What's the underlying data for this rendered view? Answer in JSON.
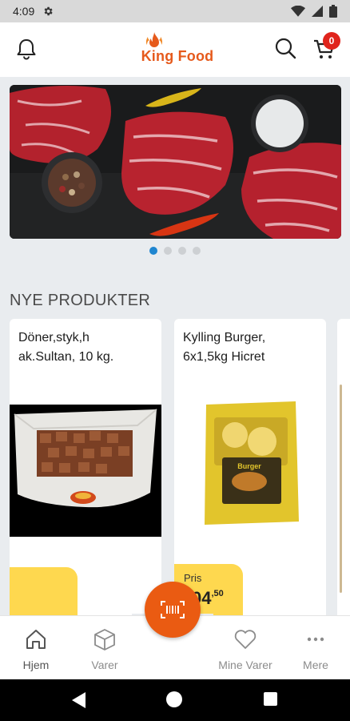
{
  "status_bar": {
    "time": "4:09"
  },
  "header": {
    "brand": "King Food",
    "cart_count": "0"
  },
  "banner": {
    "slides": 4,
    "active_slide": 1
  },
  "section": {
    "title": "NYE PRODUKTER"
  },
  "products": [
    {
      "name": "Döner,styk,h ak.Sultan, 10 kg."
    },
    {
      "name": "Kylling Burger, 6x1,5kg Hicret",
      "price_label": "Pris",
      "price_main": "04",
      "price_cents": ",50",
      "package_brand": "Burger"
    }
  ],
  "bottom_nav": [
    {
      "label": "Hjem",
      "icon": "home-icon",
      "active": true
    },
    {
      "label": "Varer",
      "icon": "box-icon",
      "active": false
    },
    {
      "label": "Mine Varer",
      "icon": "heart-icon",
      "active": false
    },
    {
      "label": "Mere",
      "icon": "more-dots-icon",
      "active": false
    }
  ],
  "colors": {
    "brand": "#e65a1c",
    "badge": "#e0241c",
    "price_bg": "#fed84f",
    "dot_active": "#1f86d0"
  }
}
